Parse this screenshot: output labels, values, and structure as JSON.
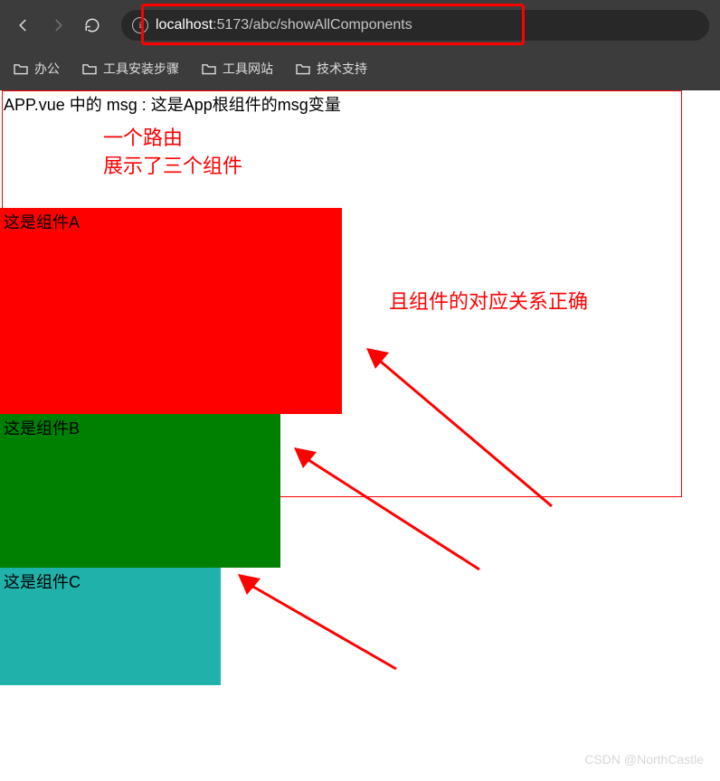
{
  "browser": {
    "url_host": "localhost",
    "url_port": ":5173",
    "url_path": "/abc/showAllComponents"
  },
  "bookmarks": [
    {
      "label": "办公"
    },
    {
      "label": "工具安装步骤"
    },
    {
      "label": "工具网站"
    },
    {
      "label": "技术支持"
    }
  ],
  "page": {
    "msg_line": "APP.vue 中的 msg : 这是App根组件的msg变量",
    "anno_line1": "一个路由",
    "anno_line2": "展示了三个组件",
    "anno_right": "且组件的对应关系正确",
    "component_a": "这是组件A",
    "component_b": "这是组件B",
    "component_c": "这是组件C"
  },
  "watermark": "CSDN @NorthCastle",
  "colors": {
    "red": "#ff0000",
    "green": "#008000",
    "teal": "#20b2aa"
  }
}
